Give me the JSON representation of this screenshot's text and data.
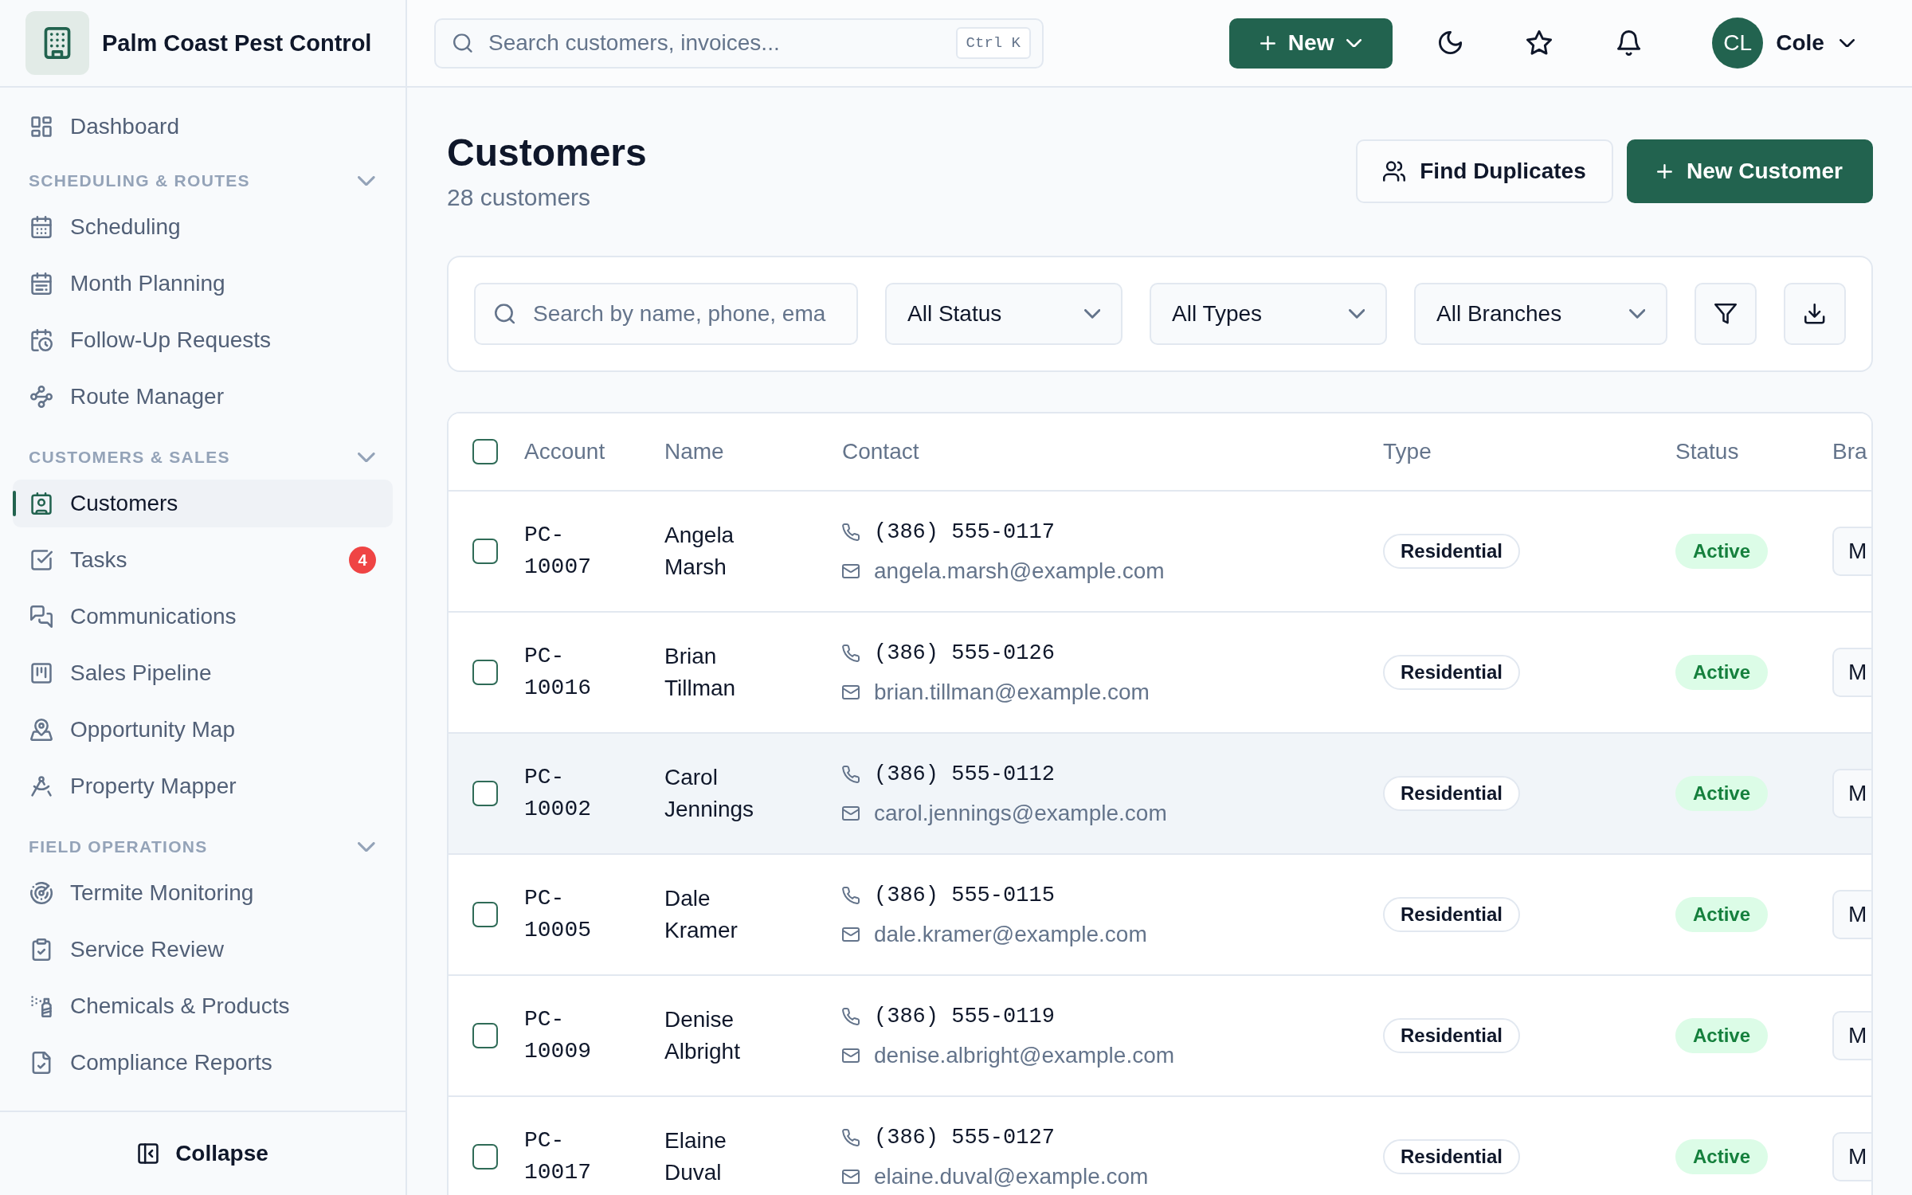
{
  "sidebar": {
    "brand": "Palm Coast Pest Control",
    "items": [
      {
        "label": "Dashboard",
        "selected": false
      }
    ],
    "sections": [
      {
        "title": "SCHEDULING & ROUTES",
        "expanded": true,
        "items": [
          {
            "label": "Scheduling",
            "selected": false
          },
          {
            "label": "Month Planning",
            "selected": false
          },
          {
            "label": "Follow-Up Requests",
            "selected": false
          },
          {
            "label": "Route Manager",
            "selected": false
          }
        ]
      },
      {
        "title": "CUSTOMERS & SALES",
        "expanded": true,
        "items": [
          {
            "label": "Customers",
            "selected": true
          },
          {
            "label": "Tasks",
            "selected": false,
            "badge": "4"
          },
          {
            "label": "Communications",
            "selected": false
          },
          {
            "label": "Sales Pipeline",
            "selected": false
          },
          {
            "label": "Opportunity Map",
            "selected": false
          },
          {
            "label": "Property Mapper",
            "selected": false
          }
        ]
      },
      {
        "title": "FIELD OPERATIONS",
        "expanded": true,
        "items": [
          {
            "label": "Termite Monitoring",
            "selected": false
          },
          {
            "label": "Service Review",
            "selected": false
          },
          {
            "label": "Chemicals & Products",
            "selected": false
          },
          {
            "label": "Compliance Reports",
            "selected": false
          }
        ]
      }
    ],
    "collapse_button": "Collapse"
  },
  "topbar": {
    "search": {
      "placeholder": "Search customers, invoices...",
      "shortcut": "Ctrl K"
    },
    "new_button": "New",
    "user": {
      "initials": "CL",
      "name": "Cole"
    }
  },
  "header": {
    "title": "Customers",
    "subtitle": "28 customers",
    "actions": [
      {
        "kind": "secondary",
        "label": "Find Duplicates"
      },
      {
        "kind": "primary",
        "label": "New Customer"
      }
    ]
  },
  "filters": {
    "search": {
      "placeholder": "Search by name, phone, ema"
    },
    "selects": [
      "All Status",
      "All Types",
      "All Branches"
    ]
  },
  "table": {
    "select_all": {
      "checked": false
    },
    "columns": [
      "Account",
      "Name",
      "Contact",
      "Type",
      "Status",
      "Bra"
    ],
    "rows": [
      {
        "checked": false,
        "highlighted": false,
        "account": "PC-10007",
        "name": "Angela Marsh",
        "phone": "(386) 555-0117",
        "email": "angela.marsh@example.com",
        "type": "Residential",
        "status": "Active",
        "branch": "M"
      },
      {
        "checked": false,
        "highlighted": false,
        "account": "PC-10016",
        "name": "Brian Tillman",
        "phone": "(386) 555-0126",
        "email": "brian.tillman@example.com",
        "type": "Residential",
        "status": "Active",
        "branch": "M"
      },
      {
        "checked": false,
        "highlighted": true,
        "account": "PC-10002",
        "name": "Carol Jennings",
        "phone": "(386) 555-0112",
        "email": "carol.jennings@example.com",
        "type": "Residential",
        "status": "Active",
        "branch": "M"
      },
      {
        "checked": false,
        "highlighted": false,
        "account": "PC-10005",
        "name": "Dale Kramer",
        "phone": "(386) 555-0115",
        "email": "dale.kramer@example.com",
        "type": "Residential",
        "status": "Active",
        "branch": "M"
      },
      {
        "checked": false,
        "highlighted": false,
        "account": "PC-10009",
        "name": "Denise Albright",
        "phone": "(386) 555-0119",
        "email": "denise.albright@example.com",
        "type": "Residential",
        "status": "Active",
        "branch": "M"
      },
      {
        "checked": false,
        "highlighted": false,
        "account": "PC-10017",
        "name": "Elaine Duval",
        "phone": "(386) 555-0127",
        "email": "elaine.duval@example.com",
        "type": "Residential",
        "status": "Active",
        "branch": "M"
      }
    ]
  }
}
